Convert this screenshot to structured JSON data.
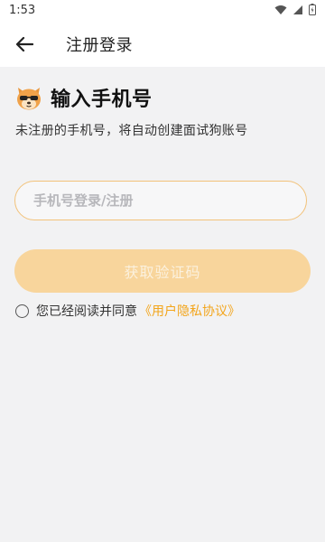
{
  "status_bar": {
    "time": "1:53",
    "icons": [
      "wifi-icon",
      "signal-icon",
      "battery-icon"
    ]
  },
  "app_bar": {
    "back_icon": "arrow-left-icon",
    "title": "注册登录"
  },
  "main": {
    "heading": "输入手机号",
    "mascot_icon": "shiba-sunglasses-icon",
    "subtitle": "未注册的手机号，将自动创建面试狗账号",
    "phone_input": {
      "value": "",
      "placeholder": "手机号登录/注册"
    },
    "get_code_button": "获取验证码",
    "agreement": {
      "checked": false,
      "text": "您已经阅读并同意",
      "link": "《用户隐私协议》"
    }
  },
  "colors": {
    "accent": "#f3a51b",
    "button_disabled": "#f8d59c",
    "input_border": "#f2c27a",
    "background": "#f2f2f3"
  }
}
